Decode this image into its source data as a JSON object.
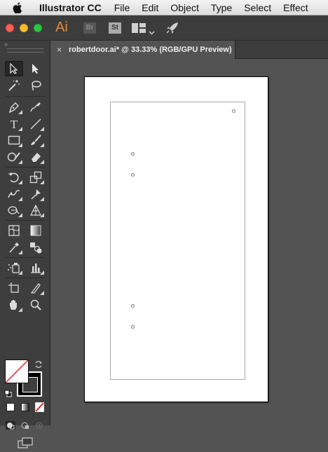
{
  "menubar": {
    "app_name": "Illustrator CC",
    "items": [
      "File",
      "Edit",
      "Object",
      "Type",
      "Select",
      "Effect"
    ]
  },
  "appbar": {
    "logo_text": "Ai",
    "bridge_label": "Br",
    "stock_label": "St"
  },
  "document": {
    "tab_close": "×",
    "tab_title": "robertdoor.ai* @ 33.33% (RGB/GPU Preview)"
  },
  "toolpanel": {
    "collapse_glyph": "‹‹",
    "type_tool_glyph": "T"
  },
  "colors": {
    "accent": "#e98a3a",
    "canvas_bg": "#535353",
    "panel_bg": "#3e3e3e",
    "artboard": "#ffffff"
  }
}
